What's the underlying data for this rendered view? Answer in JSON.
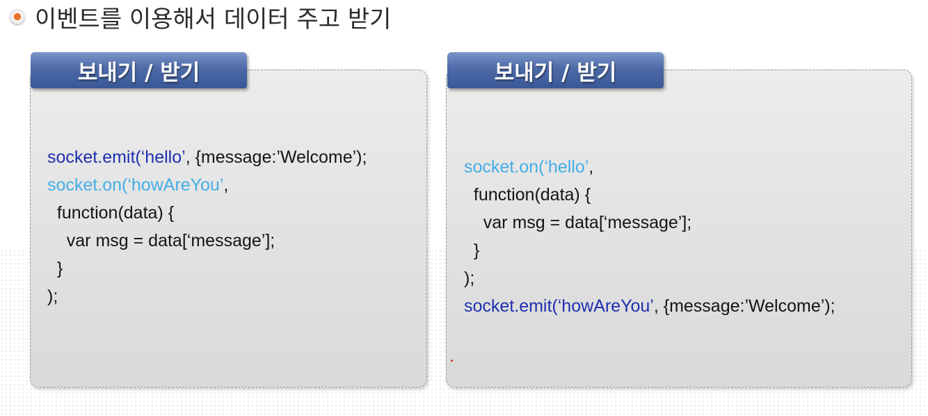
{
  "heading": {
    "text": "이벤트를 이용해서 데이터 주고 받기"
  },
  "left_panel": {
    "tab_label": "보내기 / 받기",
    "lines": [
      {
        "parts": [
          {
            "text": "socket.emit(‘hello’",
            "color": "blue"
          },
          {
            "text": ", {message:’Welcome’);",
            "color": "dark"
          }
        ]
      },
      {
        "parts": [
          {
            "text": "socket.on(‘howAreYou’",
            "color": "cyan"
          },
          {
            "text": ",",
            "color": "dark"
          }
        ]
      },
      {
        "parts": [
          {
            "text": "  function(data) {",
            "color": "dark"
          }
        ]
      },
      {
        "parts": [
          {
            "text": "    var msg = data[‘message’];",
            "color": "dark"
          }
        ]
      },
      {
        "parts": [
          {
            "text": "  }",
            "color": "dark"
          }
        ]
      },
      {
        "parts": [
          {
            "text": ");",
            "color": "dark"
          }
        ]
      }
    ]
  },
  "right_panel": {
    "tab_label": "보내기 / 받기",
    "lines": [
      {
        "parts": [
          {
            "text": "socket.on(‘hello’",
            "color": "cyan"
          },
          {
            "text": ",",
            "color": "dark"
          }
        ]
      },
      {
        "parts": [
          {
            "text": "  function(data) {",
            "color": "dark"
          }
        ]
      },
      {
        "parts": [
          {
            "text": "    var msg = data[‘message’];",
            "color": "dark"
          }
        ]
      },
      {
        "parts": [
          {
            "text": "  }",
            "color": "dark"
          }
        ]
      },
      {
        "parts": [
          {
            "text": ");",
            "color": "dark"
          }
        ]
      },
      {
        "parts": [
          {
            "text": "socket.emit(‘howAreYou’",
            "color": "blue"
          },
          {
            "text": ", {message:’Welcome’);",
            "color": "dark"
          }
        ]
      }
    ]
  },
  "colors": {
    "blue": "#1f2fb0",
    "cyan": "#45aee6",
    "dark": "#141414",
    "tab_top": "#7b95c8",
    "tab_bottom": "#3a5896",
    "bullet": "#e8742c"
  },
  "icons": {
    "bullet": "orange-bullet-icon"
  }
}
